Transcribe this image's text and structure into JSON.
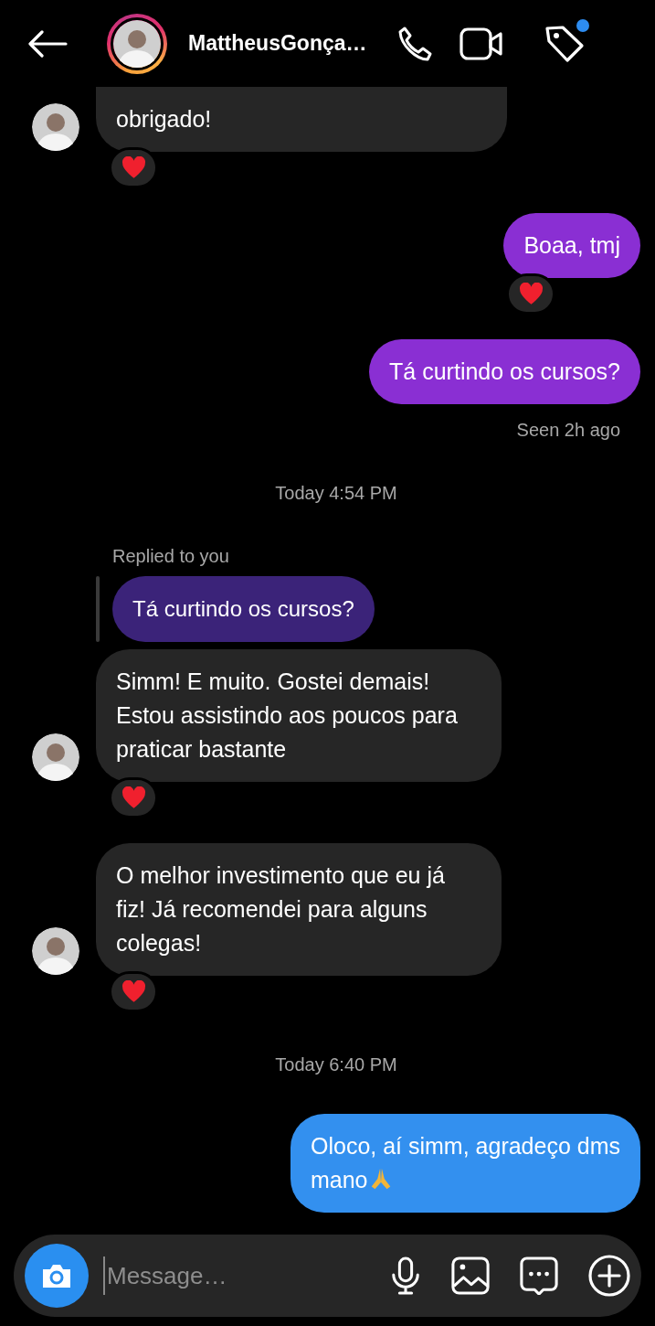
{
  "header": {
    "name": "MattheusGonça…",
    "story_ring": true,
    "tag_badge": true
  },
  "messages": [
    {
      "kind": "incoming",
      "text": "obrigado!",
      "cut_top": true,
      "avatar": true,
      "reacted": true
    },
    {
      "kind": "outgoing",
      "text": "Boaa, tmj",
      "color": "#8a2fd3",
      "reacted": true
    },
    {
      "kind": "outgoing",
      "text": "Tá curtindo os cursos?",
      "color": "#8a2fd3",
      "reacted": false
    },
    {
      "kind": "seen",
      "text": "Seen 2h ago"
    },
    {
      "kind": "time",
      "text": "Today 4:54 PM"
    },
    {
      "kind": "incoming",
      "reply": {
        "label": "Replied to you",
        "text": "Tá curtindo os cursos?"
      },
      "text": "Simm! E muito. Gostei demais!\nEstou assistindo aos poucos para\npraticar bastante",
      "avatar": true,
      "reacted": true
    },
    {
      "kind": "incoming",
      "text": "O melhor investimento que eu já\nfiz! Já recomendei para alguns\ncolegas!",
      "avatar": true,
      "reacted": true
    },
    {
      "kind": "time",
      "text": "Today 6:40 PM"
    },
    {
      "kind": "outgoing",
      "text": "Oloco, aí simm, agradeço dms\nmano",
      "color": "#3390ef",
      "praying_hands": true,
      "reacted": false
    }
  ],
  "composer": {
    "placeholder": "Message…"
  }
}
